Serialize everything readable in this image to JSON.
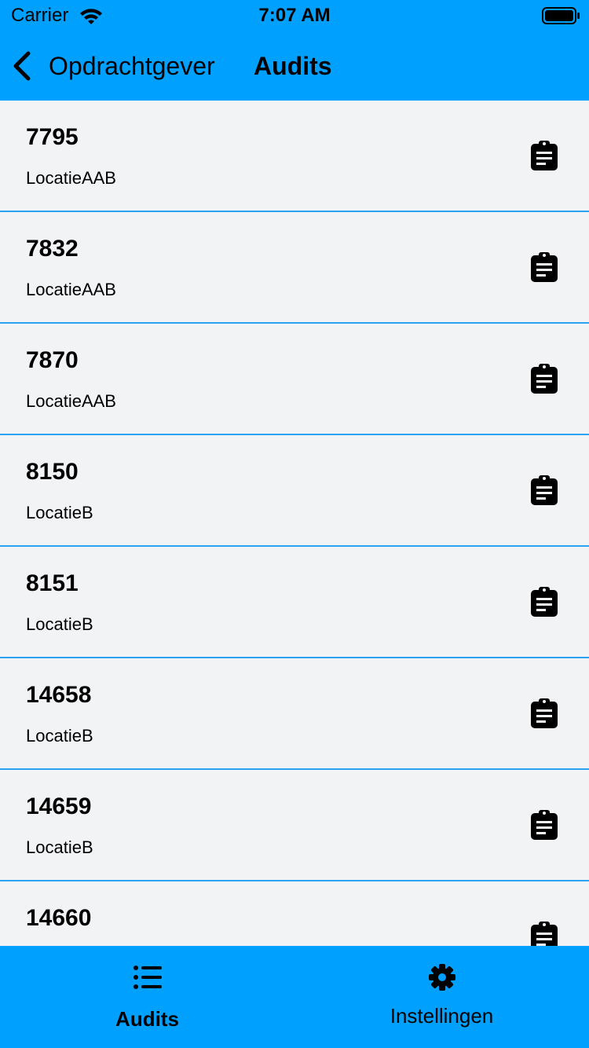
{
  "status_bar": {
    "carrier": "Carrier",
    "time": "7:07 AM",
    "wifi_icon": "wifi-icon",
    "battery_icon": "battery-icon"
  },
  "nav_bar": {
    "back_label": "Opdrachtgever",
    "title": "Audits",
    "background_color": "#00a0ff"
  },
  "audits": [
    {
      "id": "7795",
      "location": "LocatieAAB",
      "icon": "clipboard-icon"
    },
    {
      "id": "7832",
      "location": "LocatieAAB",
      "icon": "clipboard-icon"
    },
    {
      "id": "7870",
      "location": "LocatieAAB",
      "icon": "clipboard-icon"
    },
    {
      "id": "8150",
      "location": "LocatieB",
      "icon": "clipboard-icon"
    },
    {
      "id": "8151",
      "location": "LocatieB",
      "icon": "clipboard-icon"
    },
    {
      "id": "14658",
      "location": "LocatieB",
      "icon": "clipboard-icon"
    },
    {
      "id": "14659",
      "location": "LocatieB",
      "icon": "clipboard-icon"
    },
    {
      "id": "14660",
      "location": "",
      "icon": "clipboard-icon"
    }
  ],
  "tab_bar": {
    "tabs": [
      {
        "label": "Audits",
        "icon": "list-icon",
        "active": true
      },
      {
        "label": "Instellingen",
        "icon": "gear-icon",
        "active": false
      }
    ]
  },
  "colors": {
    "accent": "#00a0ff",
    "list_background": "#f2f3f5",
    "separator": "#2aa3f0"
  }
}
